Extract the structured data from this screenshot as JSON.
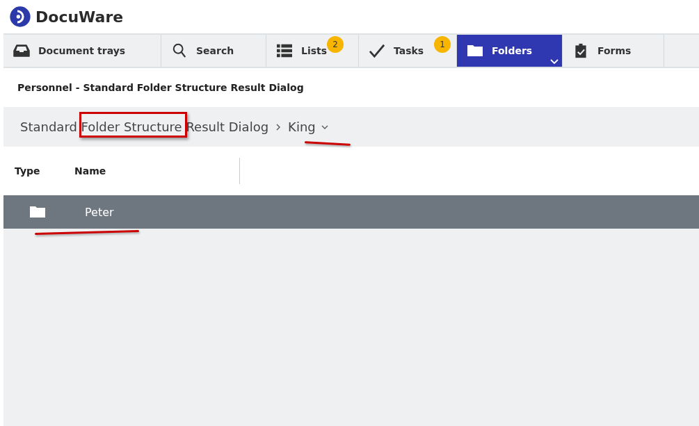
{
  "app": {
    "name": "DocuWare"
  },
  "tabs": [
    {
      "label": "Document trays",
      "kind": "tray",
      "selected": false
    },
    {
      "label": "Search",
      "kind": "search",
      "selected": false
    },
    {
      "label": "Lists",
      "kind": "list",
      "badge": "2",
      "selected": false
    },
    {
      "label": "Tasks",
      "kind": "check",
      "badge": "1",
      "selected": false
    },
    {
      "label": "Folders",
      "kind": "folder",
      "selected": true
    },
    {
      "label": "Forms",
      "kind": "clipboard",
      "selected": false
    }
  ],
  "page_title": "Personnel - Standard Folder Structure Result Dialog",
  "breadcrumb": [
    {
      "label": "Standard Folder Structure Result Dialog"
    },
    {
      "label": "King",
      "dropdown": true
    }
  ],
  "table": {
    "columns": [
      "Type",
      "Name"
    ],
    "rows": [
      {
        "kind": "folder",
        "name": "Peter",
        "selected": true
      }
    ]
  }
}
